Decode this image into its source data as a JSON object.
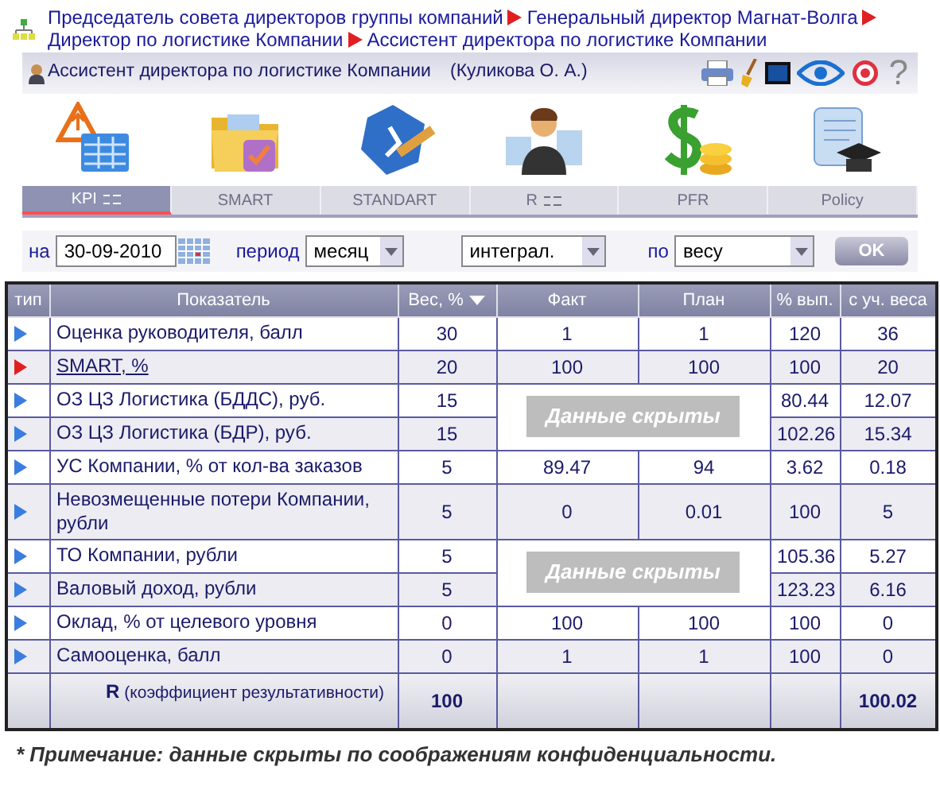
{
  "breadcrumb": [
    "Председатель совета директоров группы компаний",
    "Генеральный директор Магнат-Волга",
    "Директор по логистике Компании",
    "Ассистент директора по логистике Компании"
  ],
  "user": {
    "position": "Ассистент директора по логистике Компании",
    "name": "(Куликова О. А.)"
  },
  "help": "?",
  "modules": [
    {
      "label": "KPI",
      "selected": true,
      "kind": "kpi",
      "has_list": true
    },
    {
      "label": "SMART",
      "selected": false,
      "kind": "smart",
      "has_list": false
    },
    {
      "label": "STANDART",
      "selected": false,
      "kind": "goal",
      "has_list": false
    },
    {
      "label": "R",
      "selected": false,
      "kind": "rank",
      "has_list": true
    },
    {
      "label": "PFR",
      "selected": false,
      "kind": "money",
      "has_list": false
    },
    {
      "label": "Policy",
      "selected": false,
      "kind": "policy",
      "has_list": false
    }
  ],
  "filters": {
    "date_label": "на",
    "date": "30-09-2010",
    "period_label": "период",
    "period": "месяц",
    "mode": "интеграл.",
    "by_label": "по",
    "by": "весу",
    "ok": "OK"
  },
  "table": {
    "columns": [
      "тип",
      "Показатель",
      "Вес, %",
      "Факт",
      "План",
      "% вып.",
      "с уч. веса"
    ],
    "rows": [
      {
        "color": "#3a7de0",
        "link": false,
        "name": "Оценка руководителя, балл",
        "weight": "30",
        "fact": "1",
        "plan": "1",
        "pct": "120",
        "weighted": "36"
      },
      {
        "color": "#e02020",
        "link": true,
        "name": "SMART, %",
        "weight": "20",
        "fact": "100",
        "plan": "100",
        "pct": "100",
        "weighted": "20"
      },
      {
        "color": "#3a7de0",
        "link": false,
        "name": "ОЗ ЦЗ Логистика (БДДС), руб.",
        "weight": "15",
        "mask_label": "Данные скрыты",
        "pct": "80.44",
        "weighted": "12.07"
      },
      {
        "color": "#3a7de0",
        "link": false,
        "name": "ОЗ ЦЗ Логистика (БДР), руб.",
        "weight": "15",
        "masked": true,
        "pct": "102.26",
        "weighted": "15.34"
      },
      {
        "color": "#3a7de0",
        "link": false,
        "name": "УС Компании, % от кол-ва заказов",
        "weight": "5",
        "fact": "89.47",
        "plan": "94",
        "pct": "3.62",
        "weighted": "0.18"
      },
      {
        "color": "#3a7de0",
        "link": false,
        "name": "Невозмещенные потери Компании, рубли",
        "weight": "5",
        "fact": "0",
        "plan": "0.01",
        "pct": "100",
        "weighted": "5"
      },
      {
        "color": "#3a7de0",
        "link": false,
        "name": "ТО Компании, рубли",
        "weight": "5",
        "mask_label": "Данные скрыты",
        "pct": "105.36",
        "weighted": "5.27"
      },
      {
        "color": "#3a7de0",
        "link": false,
        "name": "Валовый доход, рубли",
        "weight": "5",
        "masked": true,
        "pct": "123.23",
        "weighted": "6.16"
      },
      {
        "color": "#3a7de0",
        "link": false,
        "name": "Оклад, % от целевого уровня",
        "weight": "0",
        "fact": "100",
        "plan": "100",
        "pct": "100",
        "weighted": "0"
      },
      {
        "color": "#3a7de0",
        "link": false,
        "name": "Самооценка, балл",
        "weight": "0",
        "fact": "1",
        "plan": "1",
        "pct": "100",
        "weighted": "0"
      }
    ],
    "total": {
      "symbol": "R",
      "label": "(коэффициент результативности)",
      "weight": "100",
      "weighted": "100.02"
    }
  },
  "note": "* Примечание: данные скрыты по соображениям конфиденциальности."
}
